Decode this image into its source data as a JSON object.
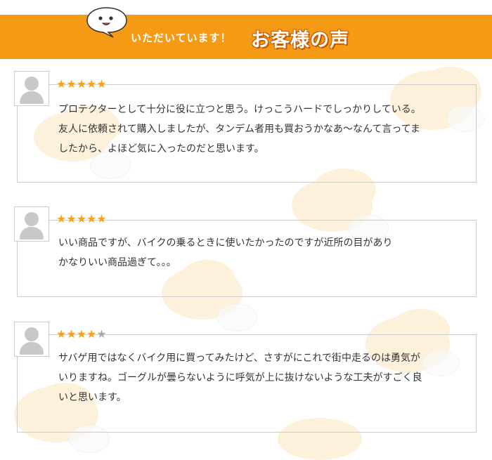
{
  "header": {
    "subtitle": "いただいています！",
    "title": "お客様の声"
  },
  "reviews": [
    {
      "rating": 5,
      "max_rating": 5,
      "lines": [
        "プロテクターとして十分に役に立つと思う。けっこうハードでしっかりしている。",
        "友人に依頼されて購入しましたが、タンデム者用も買おうかなあ～なんて言ってま",
        "したから、よほど気に入ったのだと思います。"
      ]
    },
    {
      "rating": 5,
      "max_rating": 5,
      "lines": [
        "いい商品ですが、バイクの乗るときに使いたかったのですが近所の目があり",
        "かなりいい商品過ぎて。。。"
      ]
    },
    {
      "rating": 4,
      "max_rating": 5,
      "lines": [
        "サバゲ用ではなくバイク用に買ってみたけど、さすがにこれで街中走るのは勇気が",
        "いりますね。ゴーグルが曇らないように呼気が上に抜けないような工夫がすごく良",
        "いと思います。"
      ]
    }
  ],
  "colors": {
    "header_bg": "#f59a14",
    "star_on": "#f3a31d",
    "star_off": "#aaaaaa",
    "cloud": "#fdf1dc"
  },
  "icons": {
    "mascot": "speech-bubble-face-icon",
    "avatar": "user-silhouette-icon",
    "star": "star-icon"
  }
}
